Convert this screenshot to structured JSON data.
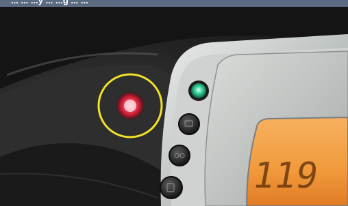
{
  "caption": {
    "text": "... ... ...y ... ...g ... ..."
  },
  "scene": {
    "description_icons": {
      "warning_light": "red-warning-light-icon",
      "green_indicator": "green-indicator-icon",
      "buttons": [
        "dashboard-button-icon",
        "dashboard-button-icon",
        "dashboard-button-icon"
      ],
      "highlight": "yellow-circle-highlight"
    },
    "lcd_reading": "119"
  },
  "colors": {
    "highlight_ring": "#f2e22a",
    "warning_red": "#ff3a4a",
    "green_light": "#3fe0a6",
    "lcd_orange": "#f19a3c",
    "caption_bar": "#5a6b82"
  }
}
